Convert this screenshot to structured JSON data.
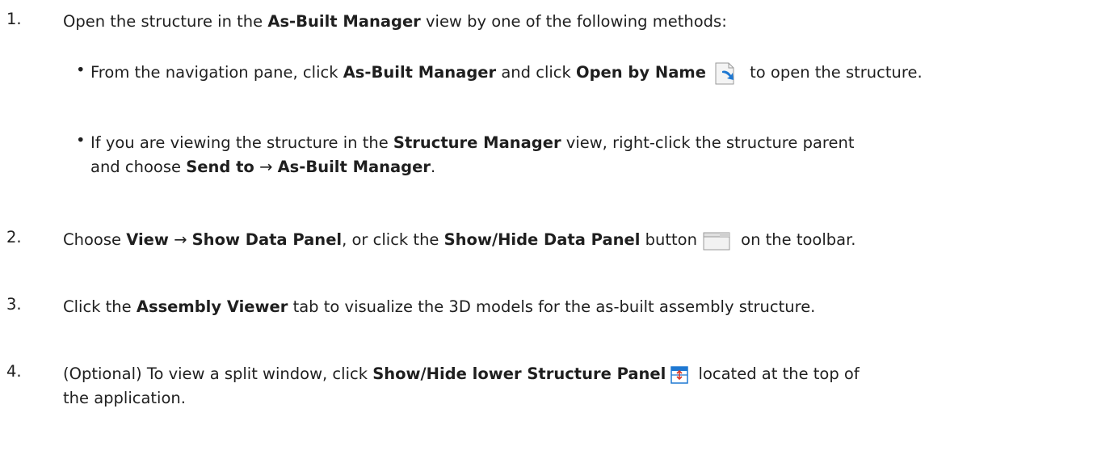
{
  "steps": [
    {
      "number": "1.",
      "parts": [
        "Open the structure in the ",
        "As-Built Manager",
        " view by one of the following methods:"
      ],
      "bullets": [
        {
          "parts": [
            "From the navigation pane, click ",
            "As-Built Manager",
            " and click ",
            "Open by Name",
            " to open the structure."
          ],
          "icon": "open-by-name-icon"
        },
        {
          "parts": [
            "If you are viewing the structure in the ",
            "Structure Manager",
            " view, right-click the structure parent",
            "and choose ",
            "Send to",
            " → ",
            "As-Built Manager",
            "."
          ]
        }
      ]
    },
    {
      "number": "2.",
      "parts": [
        "Choose ",
        "View",
        " → ",
        "Show Data Panel",
        ", or click the ",
        "Show/Hide Data Panel",
        " button",
        " on the toolbar."
      ],
      "icon": "show-hide-data-panel-icon"
    },
    {
      "number": "3.",
      "parts": [
        "Click the ",
        "Assembly Viewer",
        " tab to visualize the 3D models for the as-built assembly structure."
      ]
    },
    {
      "number": "4.",
      "parts": [
        "(Optional) To view a split window, click ",
        "Show/Hide lower Structure Panel",
        " located at the top of",
        "the application."
      ],
      "icon": "show-hide-lower-structure-panel-icon"
    }
  ],
  "colors": {
    "text": "#1f1f1f",
    "icon_blue": "#1e78d2",
    "icon_red": "#d83a2a"
  }
}
